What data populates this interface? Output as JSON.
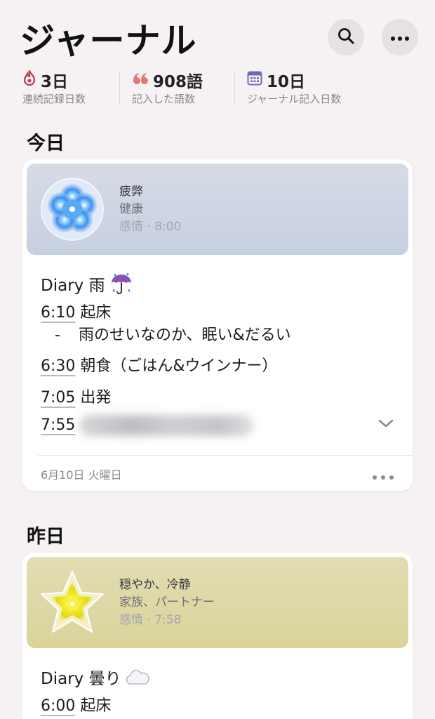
{
  "header": {
    "title": "ジャーナル",
    "search_icon": "search-icon",
    "more_icon": "ellipsis-icon"
  },
  "stats": [
    {
      "value": "3日",
      "label": "連続記録日数",
      "icon": "flame-icon",
      "color": "#b5485a"
    },
    {
      "value": "908語",
      "label": "記入した語数",
      "icon": "quote-icon",
      "color": "#e07a74"
    },
    {
      "value": "10日",
      "label": "ジャーナル記入日数",
      "icon": "calendar-icon",
      "color": "#6e6ab8"
    }
  ],
  "sections": {
    "today": "今日",
    "yesterday": "昨日"
  },
  "today_card": {
    "mood": {
      "title": "疲弊",
      "subtitle": "健康",
      "meta": "感情 · 8:00",
      "color": "#c6d0e2"
    },
    "entry_title": "Diary 雨",
    "lines": [
      {
        "time": "6:10",
        "text": " 起床"
      },
      {
        "bullet": "-",
        "text": "雨のせいなのか、眠い&だるい"
      },
      {
        "time": "6:30",
        "text": " 朝食（ごはん&ウインナー）"
      },
      {
        "time": "7:05",
        "text": " 出発"
      },
      {
        "time": "7:55",
        "text": ""
      }
    ],
    "date": "6月10日 火曜日"
  },
  "yesterday_card": {
    "mood": {
      "title": "穏やか、冷静",
      "subtitle": "家族、パートナー",
      "meta": "感情 · 7:58",
      "color": "#d9d39a"
    },
    "entry_title": "Diary 曇り",
    "lines": [
      {
        "time": "6:00",
        "text": " 起床"
      }
    ]
  }
}
